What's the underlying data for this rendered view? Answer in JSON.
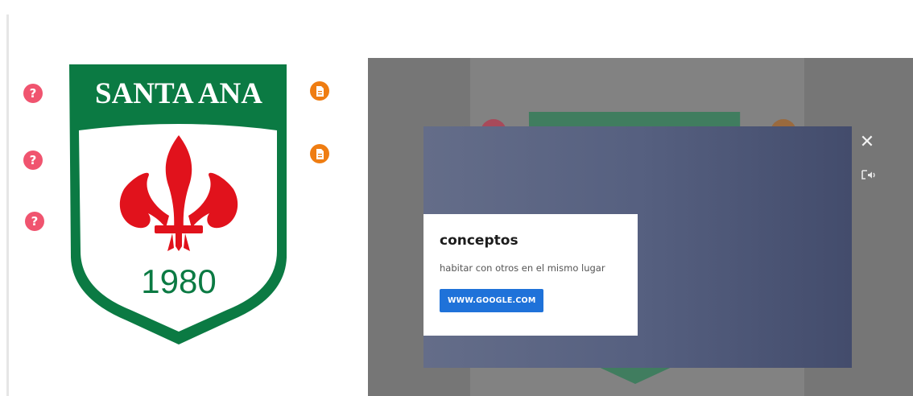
{
  "crest": {
    "top_text": "SANTA ANA",
    "year": "1980",
    "colors": {
      "green": "#0b7a43",
      "red": "#e1121c",
      "white": "#ffffff"
    }
  },
  "hotspots": {
    "left": [
      {
        "icon": "question-icon",
        "glyph": "?"
      },
      {
        "icon": "question-icon",
        "glyph": "?"
      },
      {
        "icon": "question-icon",
        "glyph": "?"
      }
    ],
    "right": [
      {
        "icon": "document-icon"
      },
      {
        "icon": "document-icon"
      }
    ],
    "colors": {
      "question": "#f0546f",
      "document": "#ef7d12"
    }
  },
  "popup": {
    "title": "conceptos",
    "description": "habitar con otros en el mismo lugar",
    "button_label": "WWW.GOOGLE.COM",
    "close_icon": "close-icon",
    "close_glyph": "✕",
    "audio_icon": "audio-description-icon"
  }
}
